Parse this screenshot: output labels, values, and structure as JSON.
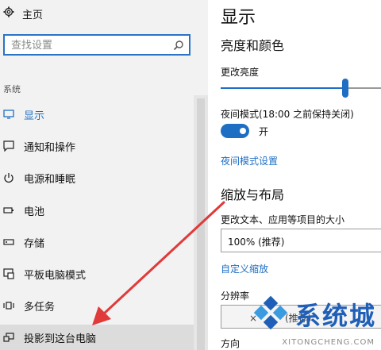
{
  "sidebar": {
    "home_label": "主页",
    "search": {
      "placeholder": "查找设置"
    },
    "section_label": "系统",
    "items": [
      {
        "label": "显示",
        "icon": "monitor-icon",
        "active": true
      },
      {
        "label": "通知和操作",
        "icon": "notification-icon"
      },
      {
        "label": "电源和睡眠",
        "icon": "power-icon"
      },
      {
        "label": "电池",
        "icon": "battery-icon"
      },
      {
        "label": "存储",
        "icon": "storage-icon"
      },
      {
        "label": "平板电脑模式",
        "icon": "tablet-icon"
      },
      {
        "label": "多任务",
        "icon": "multitask-icon"
      },
      {
        "label": "投影到这台电脑",
        "icon": "project-icon",
        "hover": true
      }
    ]
  },
  "main": {
    "page_title": "显示",
    "brightness_heading": "亮度和颜色",
    "brightness_label": "更改亮度",
    "brightness_level": 0.74,
    "night_mode_label": "夜间模式(18:00 之前保持关闭)",
    "night_mode_state": "开",
    "night_mode_settings_link": "夜间模式设置",
    "scale_heading": "缩放与布局",
    "scale_label": "更改文本、应用等项目的大小",
    "scale_value": "100% (推荐)",
    "custom_scaling_link": "自定义缩放",
    "resolution_label": "分辨率",
    "resolution_value": "(推荐)",
    "orientation_label": "方向"
  },
  "watermark": {
    "text": "系统城",
    "url": "XITONGCHENG.COM"
  },
  "colors": {
    "accent": "#1e6fc4",
    "arrow": "#e03a3a"
  }
}
